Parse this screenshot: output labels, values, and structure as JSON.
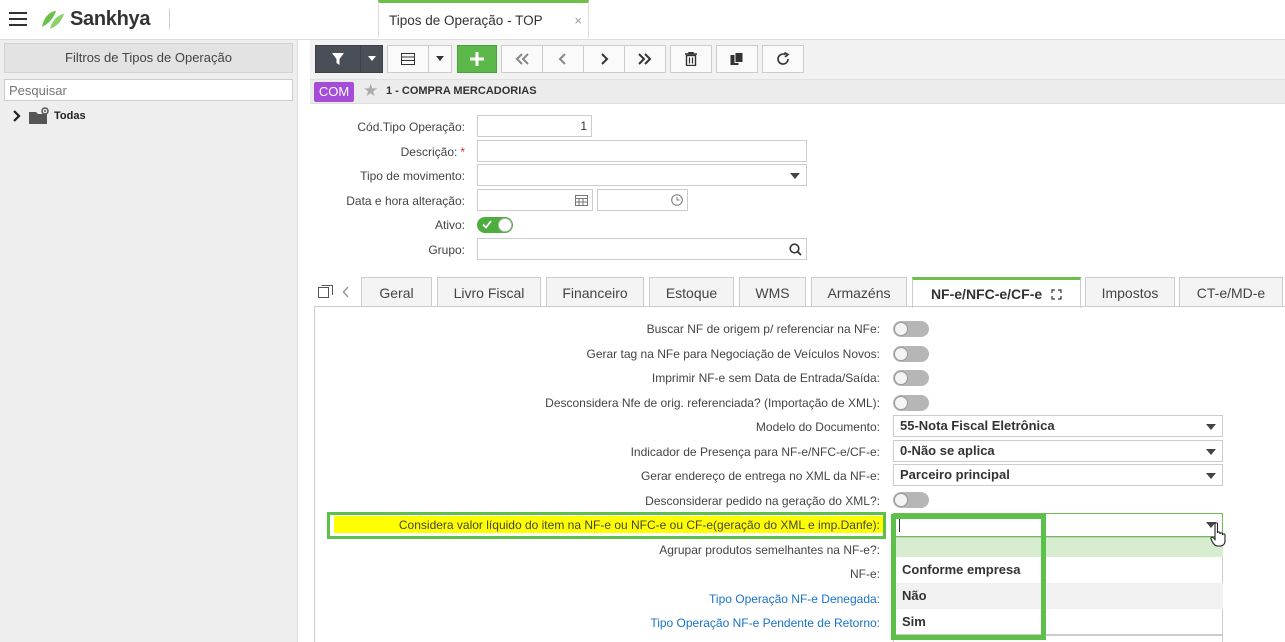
{
  "header": {
    "brand": "Sankhya",
    "tab_title": "Tipos de Operação - TOP",
    "tab_close": "×"
  },
  "left_panel": {
    "title": "Filtros de Tipos de Operação",
    "search_placeholder": "Pesquisar",
    "tree_item": "Todas"
  },
  "record": {
    "badge": "COM",
    "title": "1 - COMPRA MERCADORIAS"
  },
  "form": {
    "cod_label": "Cód.Tipo Operação:",
    "cod_value": "1",
    "descricao_label": "Descrição:",
    "required_mark": "*",
    "tipo_mov_label": "Tipo de movimento:",
    "data_label": "Data e hora alteração:",
    "ativo_label": "Ativo:",
    "ativo_on": true,
    "grupo_label": "Grupo:"
  },
  "tabs": [
    "Geral",
    "Livro Fiscal",
    "Financeiro",
    "Estoque",
    "WMS",
    "Armazéns",
    "NF-e/NFC-e/CF-e",
    "Impostos",
    "CT-e/MD-e"
  ],
  "active_tab": "NF-e/NFC-e/CF-e",
  "nfe_fields": {
    "buscar_nf": "Buscar NF de origem p/ referenciar na NFe:",
    "gerar_tag": "Gerar tag na NFe para Negociação de Veículos Novos:",
    "imprimir": "Imprimir NF-e sem Data de Entrada/Saída:",
    "desconsidera_nfe": "Desconsidera Nfe de orig. referenciada? (Importação de XML):",
    "modelo_label": "Modelo do Documento:",
    "modelo_value": "55-Nota Fiscal Eletrônica",
    "indicador_label": "Indicador de Presença para NF-e/NFC-e/CF-e:",
    "indicador_value": "0-Não se aplica",
    "endereco_label": "Gerar endereço de entrega no XML da NF-e:",
    "endereco_value": "Parceiro principal",
    "desconsiderar_pedido": "Desconsiderar pedido na geração do XML?:",
    "considera_valor": "Considera valor líquido do item na NF-e ou NFC-e ou CF-e(geração do XML e imp.Danfe):",
    "agrupar": "Agrupar produtos semelhantes na NF-e?:",
    "nfe_label": "NF-e:",
    "denegada": "Tipo Operação NF-e Denegada:",
    "pendente": "Tipo Operação NF-e Pendente de Retorno:"
  },
  "dropdown": {
    "options": [
      "",
      "Conforme empresa",
      "Não",
      "Sim"
    ]
  },
  "colors": {
    "brand_green": "#6cc04a",
    "highlight_yellow": "#ffff00",
    "badge_purple": "#a54dd9",
    "link_blue": "#1a73c8"
  }
}
